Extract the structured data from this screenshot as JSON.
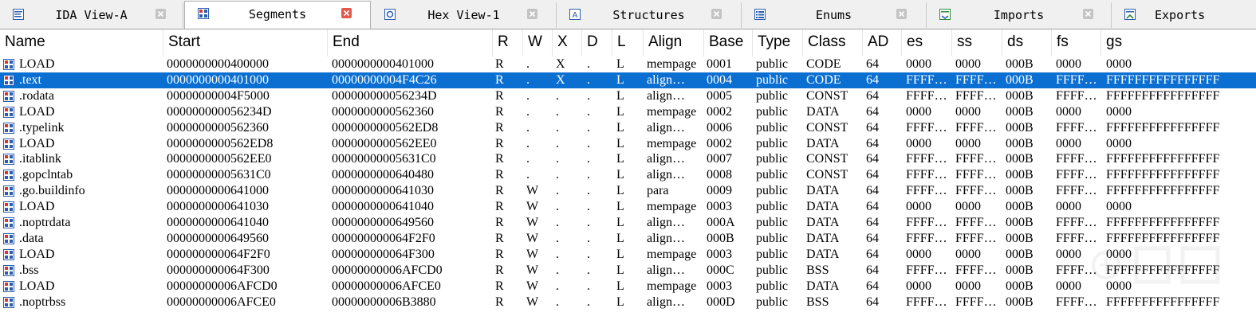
{
  "tabs": [
    {
      "label": "IDA View-A",
      "icon": "ida-view-icon",
      "active": false
    },
    {
      "label": "Segments",
      "icon": "segments-icon",
      "active": true
    },
    {
      "label": "Hex View-1",
      "icon": "hex-view-icon",
      "active": false
    },
    {
      "label": "Structures",
      "icon": "structures-icon",
      "active": false
    },
    {
      "label": "Enums",
      "icon": "enums-icon",
      "active": false
    },
    {
      "label": "Imports",
      "icon": "imports-icon",
      "active": false
    },
    {
      "label": "Exports",
      "icon": "exports-icon",
      "active": false
    }
  ],
  "columns": [
    "Name",
    "Start",
    "End",
    "R",
    "W",
    "X",
    "D",
    "L",
    "Align",
    "Base",
    "Type",
    "Class",
    "AD",
    "es",
    "ss",
    "ds",
    "fs",
    "gs"
  ],
  "rows": [
    {
      "name": "LOAD",
      "start": "0000000000400000",
      "end": "0000000000401000",
      "r": "R",
      "w": ".",
      "x": "X",
      "d": ".",
      "l": "L",
      "align": "mempage",
      "base": "0001",
      "type": "public",
      "class": "CODE",
      "ad": "64",
      "es": "0000",
      "ss": "0000",
      "ds": "000B",
      "fs": "0000",
      "gs": "0000"
    },
    {
      "name": ".text",
      "start": "0000000000401000",
      "end": "00000000004F4C26",
      "r": "R",
      "w": ".",
      "x": "X",
      "d": ".",
      "l": "L",
      "align": "align…",
      "base": "0004",
      "type": "public",
      "class": "CODE",
      "ad": "64",
      "es": "FFFF…",
      "ss": "FFFF…",
      "ds": "000B",
      "fs": "FFFF…",
      "gs": "FFFFFFFFFFFFFFFF",
      "selected": true
    },
    {
      "name": ".rodata",
      "start": "00000000004F5000",
      "end": "000000000056234D",
      "r": "R",
      "w": ".",
      "x": ".",
      "d": ".",
      "l": "L",
      "align": "align…",
      "base": "0005",
      "type": "public",
      "class": "CONST",
      "ad": "64",
      "es": "FFFF…",
      "ss": "FFFF…",
      "ds": "000B",
      "fs": "FFFF…",
      "gs": "FFFFFFFFFFFFFFFF"
    },
    {
      "name": "LOAD",
      "start": "000000000056234D",
      "end": "0000000000562360",
      "r": "R",
      "w": ".",
      "x": ".",
      "d": ".",
      "l": "L",
      "align": "mempage",
      "base": "0002",
      "type": "public",
      "class": "DATA",
      "ad": "64",
      "es": "0000",
      "ss": "0000",
      "ds": "000B",
      "fs": "0000",
      "gs": "0000"
    },
    {
      "name": ".typelink",
      "start": "0000000000562360",
      "end": "0000000000562ED8",
      "r": "R",
      "w": ".",
      "x": ".",
      "d": ".",
      "l": "L",
      "align": "align…",
      "base": "0006",
      "type": "public",
      "class": "CONST",
      "ad": "64",
      "es": "FFFF…",
      "ss": "FFFF…",
      "ds": "000B",
      "fs": "FFFF…",
      "gs": "FFFFFFFFFFFFFFFF"
    },
    {
      "name": "LOAD",
      "start": "0000000000562ED8",
      "end": "0000000000562EE0",
      "r": "R",
      "w": ".",
      "x": ".",
      "d": ".",
      "l": "L",
      "align": "mempage",
      "base": "0002",
      "type": "public",
      "class": "DATA",
      "ad": "64",
      "es": "0000",
      "ss": "0000",
      "ds": "000B",
      "fs": "0000",
      "gs": "0000"
    },
    {
      "name": ".itablink",
      "start": "0000000000562EE0",
      "end": "00000000005631C0",
      "r": "R",
      "w": ".",
      "x": ".",
      "d": ".",
      "l": "L",
      "align": "align…",
      "base": "0007",
      "type": "public",
      "class": "CONST",
      "ad": "64",
      "es": "FFFF…",
      "ss": "FFFF…",
      "ds": "000B",
      "fs": "FFFF…",
      "gs": "FFFFFFFFFFFFFFFF"
    },
    {
      "name": ".gopclntab",
      "start": "00000000005631C0",
      "end": "0000000000640480",
      "r": "R",
      "w": ".",
      "x": ".",
      "d": ".",
      "l": "L",
      "align": "align…",
      "base": "0008",
      "type": "public",
      "class": "CONST",
      "ad": "64",
      "es": "FFFF…",
      "ss": "FFFF…",
      "ds": "000B",
      "fs": "FFFF…",
      "gs": "FFFFFFFFFFFFFFFF"
    },
    {
      "name": ".go.buildinfo",
      "start": "0000000000641000",
      "end": "0000000000641030",
      "r": "R",
      "w": "W",
      "x": ".",
      "d": ".",
      "l": "L",
      "align": "para",
      "base": "0009",
      "type": "public",
      "class": "DATA",
      "ad": "64",
      "es": "FFFF…",
      "ss": "FFFF…",
      "ds": "000B",
      "fs": "FFFF…",
      "gs": "FFFFFFFFFFFFFFFF"
    },
    {
      "name": "LOAD",
      "start": "0000000000641030",
      "end": "0000000000641040",
      "r": "R",
      "w": "W",
      "x": ".",
      "d": ".",
      "l": "L",
      "align": "mempage",
      "base": "0003",
      "type": "public",
      "class": "DATA",
      "ad": "64",
      "es": "0000",
      "ss": "0000",
      "ds": "000B",
      "fs": "0000",
      "gs": "0000"
    },
    {
      "name": ".noptrdata",
      "start": "0000000000641040",
      "end": "0000000000649560",
      "r": "R",
      "w": "W",
      "x": ".",
      "d": ".",
      "l": "L",
      "align": "align…",
      "base": "000A",
      "type": "public",
      "class": "DATA",
      "ad": "64",
      "es": "FFFF…",
      "ss": "FFFF…",
      "ds": "000B",
      "fs": "FFFF…",
      "gs": "FFFFFFFFFFFFFFFF"
    },
    {
      "name": ".data",
      "start": "0000000000649560",
      "end": "000000000064F2F0",
      "r": "R",
      "w": "W",
      "x": ".",
      "d": ".",
      "l": "L",
      "align": "align…",
      "base": "000B",
      "type": "public",
      "class": "DATA",
      "ad": "64",
      "es": "FFFF…",
      "ss": "FFFF…",
      "ds": "000B",
      "fs": "FFFF…",
      "gs": "FFFFFFFFFFFFFFFF"
    },
    {
      "name": "LOAD",
      "start": "000000000064F2F0",
      "end": "000000000064F300",
      "r": "R",
      "w": "W",
      "x": ".",
      "d": ".",
      "l": "L",
      "align": "mempage",
      "base": "0003",
      "type": "public",
      "class": "DATA",
      "ad": "64",
      "es": "0000",
      "ss": "0000",
      "ds": "000B",
      "fs": "0000",
      "gs": "0000"
    },
    {
      "name": ".bss",
      "start": "000000000064F300",
      "end": "00000000006AFCD0",
      "r": "R",
      "w": "W",
      "x": ".",
      "d": ".",
      "l": "L",
      "align": "align…",
      "base": "000C",
      "type": "public",
      "class": "BSS",
      "ad": "64",
      "es": "FFFF…",
      "ss": "FFFF…",
      "ds": "000B",
      "fs": "FFFF…",
      "gs": "FFFFFFFFFFFFFFFF"
    },
    {
      "name": "LOAD",
      "start": "00000000006AFCD0",
      "end": "00000000006AFCE0",
      "r": "R",
      "w": "W",
      "x": ".",
      "d": ".",
      "l": "L",
      "align": "mempage",
      "base": "0003",
      "type": "public",
      "class": "DATA",
      "ad": "64",
      "es": "0000",
      "ss": "0000",
      "ds": "000B",
      "fs": "0000",
      "gs": "0000"
    },
    {
      "name": ".noptrbss",
      "start": "00000000006AFCE0",
      "end": "00000000006B3880",
      "r": "R",
      "w": "W",
      "x": ".",
      "d": ".",
      "l": "L",
      "align": "align…",
      "base": "000D",
      "type": "public",
      "class": "BSS",
      "ad": "64",
      "es": "FFFF…",
      "ss": "FFFF…",
      "ds": "000B",
      "fs": "FFFF…",
      "gs": "FFFFFFFFFFFFFFFF"
    }
  ],
  "colors": {
    "selection": "#0A6FD1",
    "active_close": "#E35A4D",
    "tab_bar": "#F0F0F0"
  }
}
